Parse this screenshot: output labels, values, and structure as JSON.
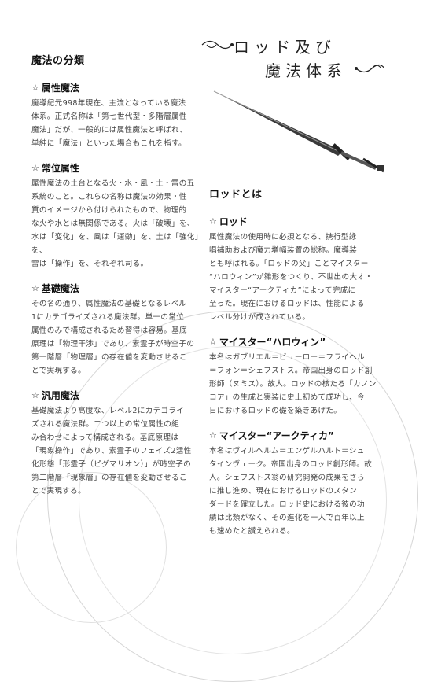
{
  "header": {
    "title_line1": "ロッド及び",
    "title_line2": "魔法体系"
  },
  "left": {
    "section_title": "魔法の分類",
    "entries": [
      {
        "heading": "属性魔法",
        "lines": [
          "魔導紀元998年現在、主流となっている魔法",
          "体系。正式名称は「第七世代型・多階層属性",
          "魔法」だが、一般的には属性魔法と呼ばれ、",
          "単純に「魔法」といった場合もこれを指す。"
        ]
      },
      {
        "heading": "常位属性",
        "lines": [
          "属性魔法の土台となる火・水・風・土・雷の五",
          "系統のこと。これらの名称は魔法の効果・性",
          "質のイメージから付けられたもので、物理的",
          "な火や水とは無関係である。火は「破壊」を、",
          "水は「変化」を、風は「運動」を、土は「強化」を、",
          "雷は「操作」を、それぞれ司る。"
        ]
      },
      {
        "heading": "基礎魔法",
        "lines": [
          "その名の通り、属性魔法の基礎となるレベル",
          "1にカテゴライズされる魔法群。単一の常位",
          "属性のみで構成されるため習得は容易。基底",
          "原理は「物理干渉」であり、素霊子が時空子の",
          "第一階層「物理層」の存在値を変動させるこ",
          "とで実現する。"
        ]
      },
      {
        "heading": "汎用魔法",
        "lines": [
          "基礎魔法より高度な、レベル2にカテゴライ",
          "ズされる魔法群。二つ以上の常位属性の組",
          "み合わせによって構成される。基底原理は",
          "「現象操作」であり、素霊子のフェイズ2活性",
          "化形態「形霊子（ピグマリオン）」が時空子の",
          "第二階層「現象層」の存在値を変動させるこ",
          "とで実現する。"
        ]
      }
    ]
  },
  "right": {
    "section_title": "ロッドとは",
    "entries": [
      {
        "heading": "ロッド",
        "lines": [
          "属性魔法の使用時に必須となる、携行型詠",
          "唱補助および魔力増幅装置の総称。魔導装",
          "とも呼ばれる。「ロッドの父」ことマイスター",
          "“ハロウィン”が雛形をつくり、不世出の大オ・",
          "マイスター“アークティカ”によって完成に",
          "至った。現在におけるロッドは、性能による",
          "レベル分けが成されている。"
        ]
      },
      {
        "heading": "マイスター“ハロウィン”",
        "lines": [
          "本名はガブリエル＝ビューロー＝フライヘル",
          "＝フォン＝シェフストス。帝国出身のロッド創",
          "形師（ヌミス）。故人。ロッドの核たる「カノン",
          "コア」の生成と実装に史上初めて成功し、今",
          "日におけるロッドの礎を築きあげた。"
        ]
      },
      {
        "heading": "マイスター“アークティカ”",
        "lines": [
          "本名はヴィルヘルム＝エンゲルハルト＝シュ",
          "タインヴェーク。帝国出身のロッド創形師。故",
          "人。シェフストス翁の研究開発の成果をさら",
          "に推し進め、現在におけるロッドのスタン",
          "ダードを確立した。ロッド史における彼の功",
          "績は比類がなく、その進化を一人で百年以上",
          "も速めたと讃えられる。"
        ]
      }
    ]
  }
}
